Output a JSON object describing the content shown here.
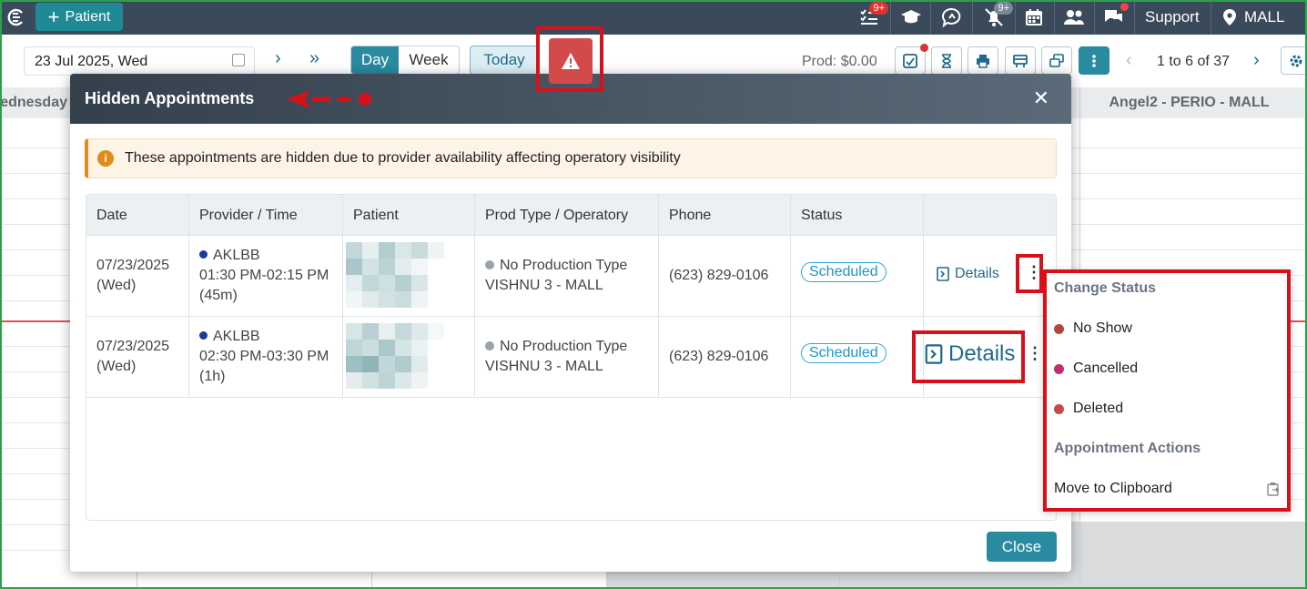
{
  "topbar": {
    "patient_label": "Patient",
    "notifications": [
      {
        "icon": "task-list-icon",
        "badge": "9+"
      },
      {
        "icon": "graduation-cap-icon",
        "badge": ""
      },
      {
        "icon": "chat-bubble-icon",
        "badge": ""
      },
      {
        "icon": "bell-off-icon",
        "badge": "9+"
      },
      {
        "icon": "calendar-icon",
        "badge": ""
      },
      {
        "icon": "users-icon",
        "badge": ""
      },
      {
        "icon": "messages-icon",
        "badge": ""
      }
    ],
    "support_label": "Support",
    "location_label": "MALL"
  },
  "toolbar": {
    "date_value": "23 Jul 2025, Wed",
    "view_day": "Day",
    "view_week": "Week",
    "today_label": "Today",
    "production": "Prod: $0.00",
    "pager": "1 to 6 of 37"
  },
  "calendar": {
    "left_column": "ednesday",
    "right_column": "Angel2 - PERIO - MALL"
  },
  "modal": {
    "title": "Hidden Appointments",
    "alert_text": "These appointments are hidden due to provider availability affecting operatory visibility",
    "columns": [
      "Date",
      "Provider / Time",
      "Patient",
      "Prod Type / Operatory",
      "Phone",
      "Status"
    ],
    "rows": [
      {
        "date": "07/23/2025",
        "day": "(Wed)",
        "provider": "AKLBB",
        "time": "01:30 PM-02:15 PM",
        "duration": "(45m)",
        "prod_type": "No Production Type",
        "operatory": "VISHNU 3 - MALL",
        "phone": "(623) 829-0106",
        "status": "Scheduled",
        "details_label": "Details"
      },
      {
        "date": "07/23/2025",
        "day": "(Wed)",
        "provider": "AKLBB",
        "time": "02:30 PM-03:30 PM",
        "duration": "(1h)",
        "prod_type": "No Production Type",
        "operatory": "VISHNU 3 - MALL",
        "phone": "(623) 829-0106",
        "status": "Scheduled",
        "details_label": "Details"
      }
    ],
    "close_label": "Close"
  },
  "menu": {
    "change_status_heading": "Change Status",
    "statuses": [
      {
        "label": "No Show",
        "color": "#b5473a"
      },
      {
        "label": "Cancelled",
        "color": "#c0306e"
      },
      {
        "label": "Deleted",
        "color": "#c64848"
      }
    ],
    "actions_heading": "Appointment Actions",
    "clipboard_label": "Move to Clipboard"
  },
  "colors": {
    "accent": "#2a8aa0",
    "annotation_red": "#d8101a",
    "header_dark": "#3a4a5a"
  }
}
